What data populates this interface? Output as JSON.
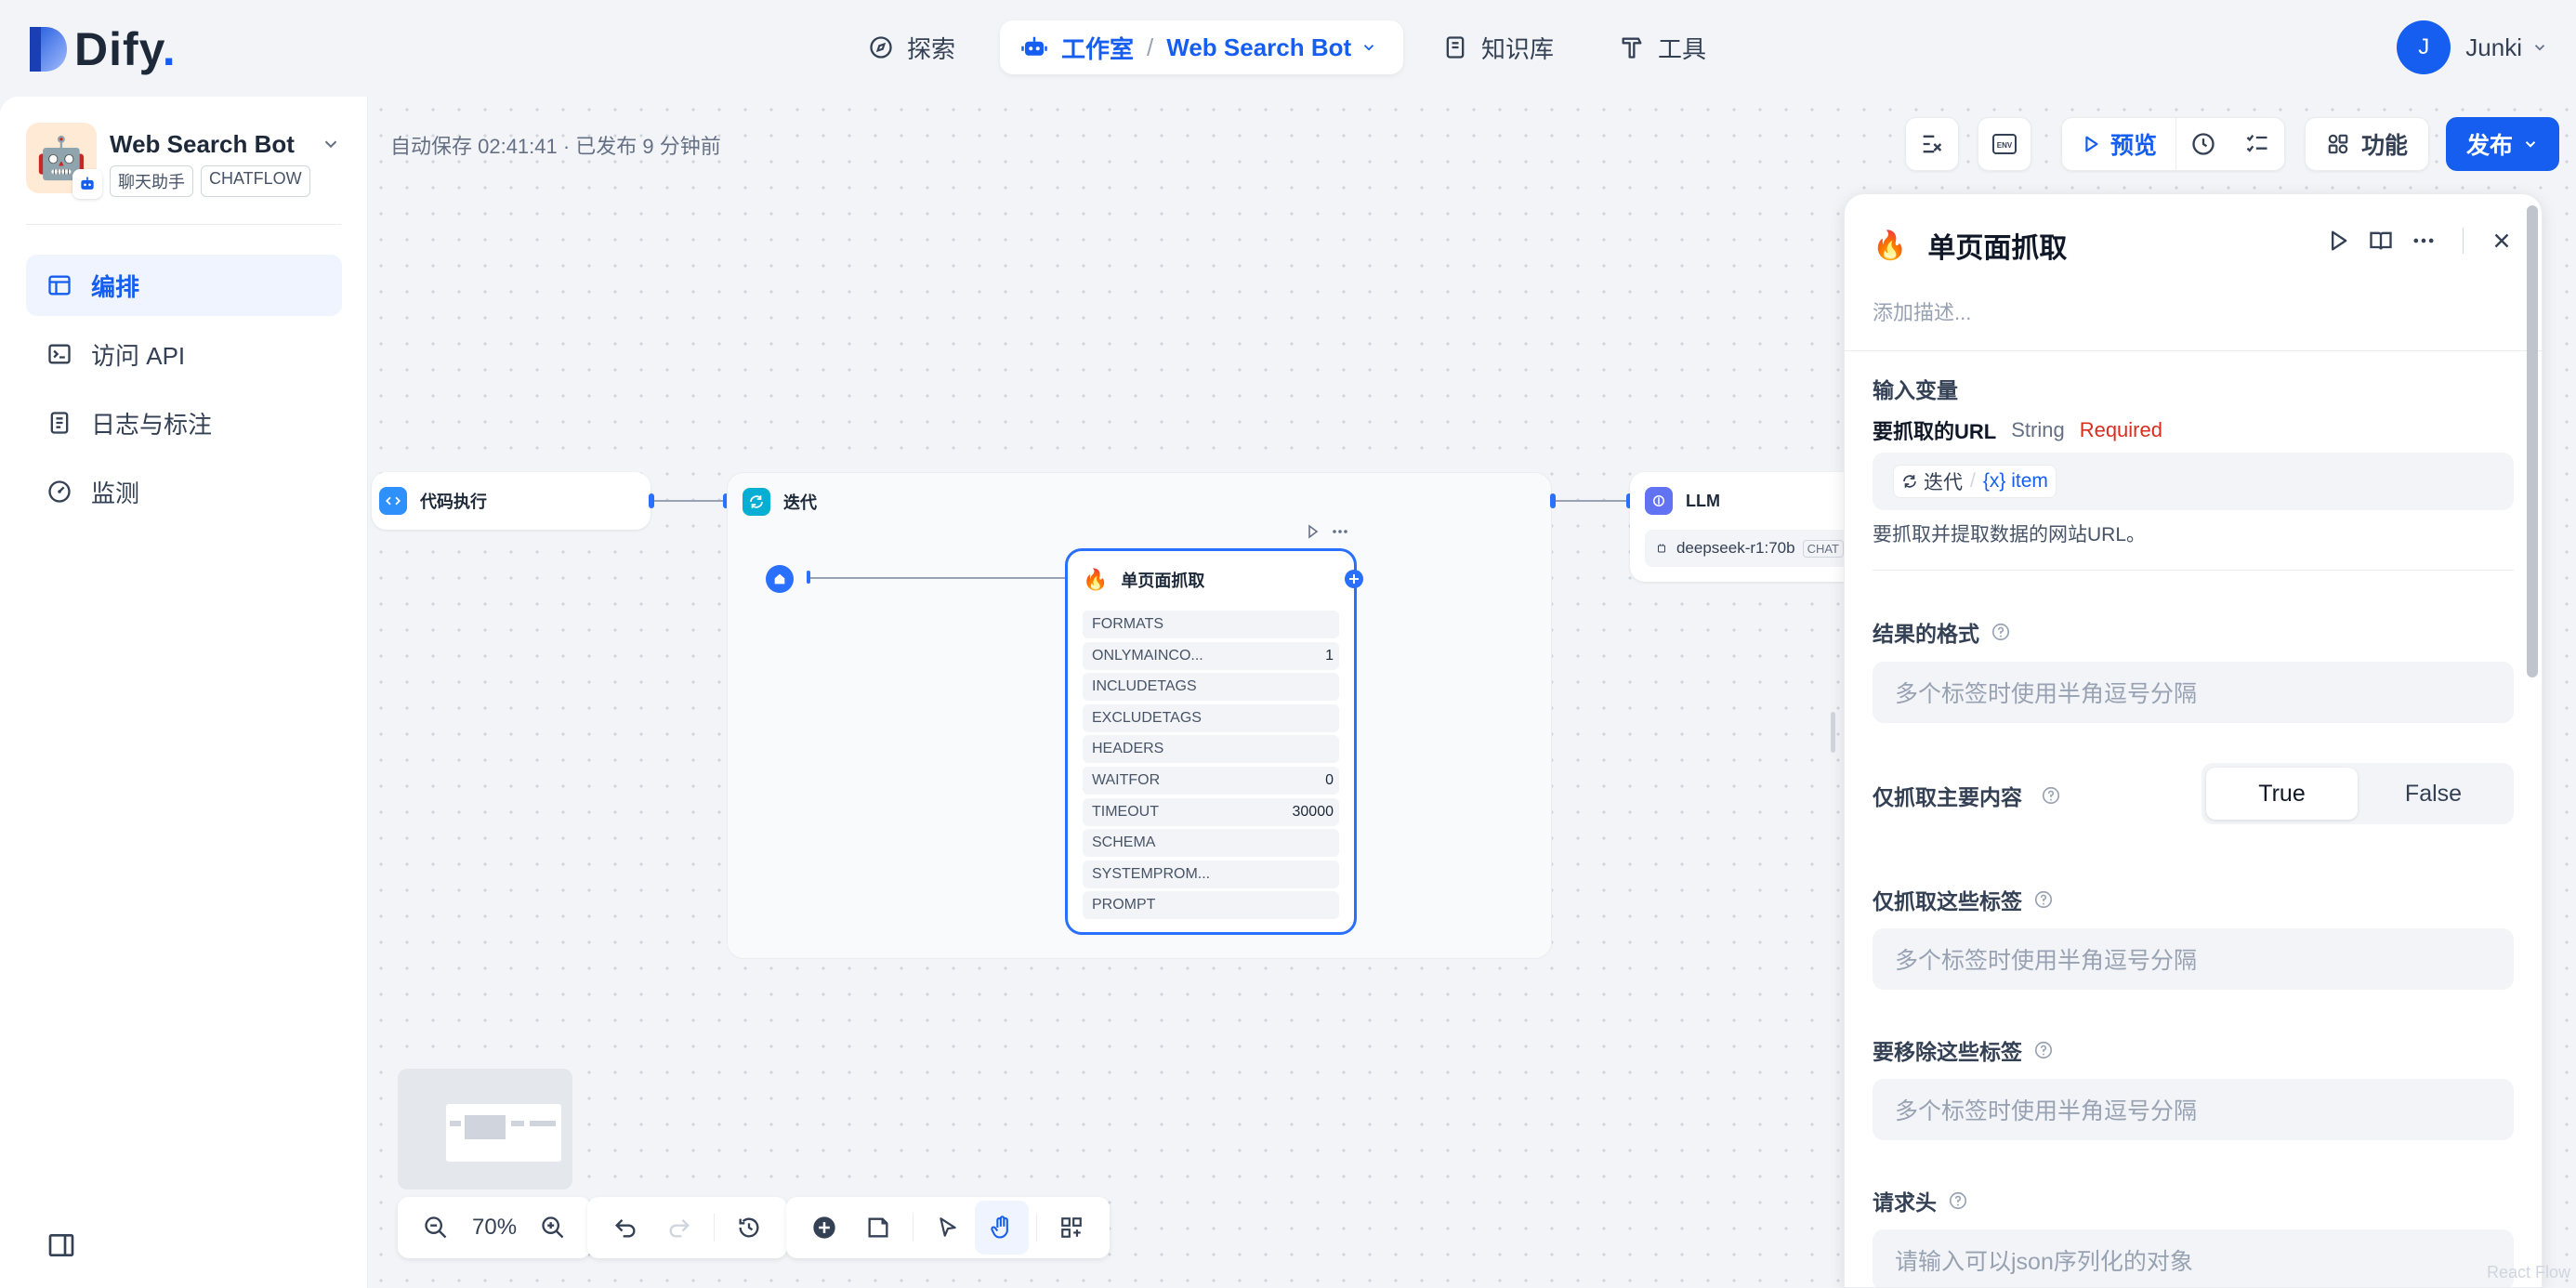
{
  "topbar": {
    "logo_text": "Dify",
    "logo_dot": ".",
    "nav": {
      "explore": "探索",
      "studio": "工作室",
      "breadcrumb_sep": "/",
      "app": "Web Search Bot",
      "knowledge": "知识库",
      "tools": "工具"
    },
    "user": {
      "avatar_letter": "J",
      "name": "Junki"
    }
  },
  "sidebar": {
    "app_name": "Web Search Bot",
    "app_icon": "🤖",
    "tags": [
      "聊天助手",
      "CHATFLOW"
    ],
    "items": [
      {
        "label": "编排",
        "icon": "layout-icon",
        "active": true
      },
      {
        "label": "访问 API",
        "icon": "terminal-icon",
        "active": false
      },
      {
        "label": "日志与标注",
        "icon": "file-list-icon",
        "active": false
      },
      {
        "label": "监测",
        "icon": "gauge-icon",
        "active": false
      }
    ]
  },
  "canvas": {
    "autosave": "自动保存 02:41:41 · 已发布 9 分钟前",
    "toolbar": {
      "preview": "预览",
      "features": "功能",
      "publish": "发布",
      "env": "ENV"
    },
    "nodes": {
      "code": {
        "title": "代码执行"
      },
      "iteration": {
        "title": "迭代"
      },
      "llm": {
        "title": "LLM",
        "model": "deepseek-r1:70b",
        "model_tag": "CHAT"
      },
      "scrape": {
        "icon": "🔥",
        "title": "单页面抓取",
        "params": [
          {
            "name": "FORMATS",
            "value": ""
          },
          {
            "name": "ONLYMAINCO...",
            "value": "1"
          },
          {
            "name": "INCLUDETAGS",
            "value": ""
          },
          {
            "name": "EXCLUDETAGS",
            "value": ""
          },
          {
            "name": "HEADERS",
            "value": ""
          },
          {
            "name": "WAITFOR",
            "value": "0"
          },
          {
            "name": "TIMEOUT",
            "value": "30000"
          },
          {
            "name": "SCHEMA",
            "value": ""
          },
          {
            "name": "SYSTEMPROM...",
            "value": ""
          },
          {
            "name": "PROMPT",
            "value": ""
          }
        ]
      }
    },
    "zoom": "70%"
  },
  "panel": {
    "icon": "🔥",
    "title": "单页面抓取",
    "description_placeholder": "添加描述...",
    "input_vars_label": "输入变量",
    "var": {
      "name": "要抓取的URL",
      "type": "String",
      "required": "Required",
      "ref_node": "迭代",
      "ref_sep": "/",
      "ref_var": "{x} item",
      "hint": "要抓取并提取数据的网站URL。"
    },
    "format": {
      "label": "结果的格式",
      "placeholder": "多个标签时使用半角逗号分隔"
    },
    "only_main": {
      "label": "仅抓取主要内容",
      "true_label": "True",
      "false_label": "False",
      "selected": "True"
    },
    "include_tags": {
      "label": "仅抓取这些标签",
      "placeholder": "多个标签时使用半角逗号分隔"
    },
    "exclude_tags": {
      "label": "要移除这些标签",
      "placeholder": "多个标签时使用半角逗号分隔"
    },
    "headers": {
      "label": "请求头",
      "placeholder": "请输入可以json序列化的对象"
    },
    "watermark": "React Flow"
  },
  "colors": {
    "accent": "#155eef",
    "required": "#d92d20",
    "node_border": "#2970ff"
  }
}
